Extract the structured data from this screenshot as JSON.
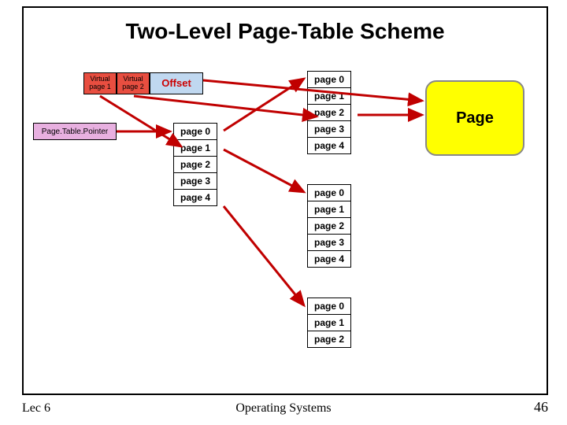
{
  "title": "Two-Level Page-Table Scheme",
  "virtual_address": {
    "vp1": "Virtual page 1",
    "vp2": "Virtual page 2",
    "offset": "Offset"
  },
  "ptp_label": "Page.Table.Pointer",
  "level1_table": [
    "page 0",
    "page 1",
    "page 2",
    "page 3",
    "page 4"
  ],
  "level2_tables": [
    [
      "page 0",
      "page 1",
      "page 2",
      "page 3",
      "page 4"
    ],
    [
      "page 0",
      "page 1",
      "page 2",
      "page 3",
      "page 4"
    ],
    [
      "page 0",
      "page 1",
      "page 2"
    ]
  ],
  "page_box": "Page",
  "footer": {
    "left": "Lec 6",
    "center": "Operating Systems",
    "right": "46"
  },
  "colors": {
    "red": "#e84e40",
    "blue": "#c0d8f0",
    "pink": "#e8b0e0",
    "yellow": "#ffff00",
    "arrow": "#c00000"
  }
}
